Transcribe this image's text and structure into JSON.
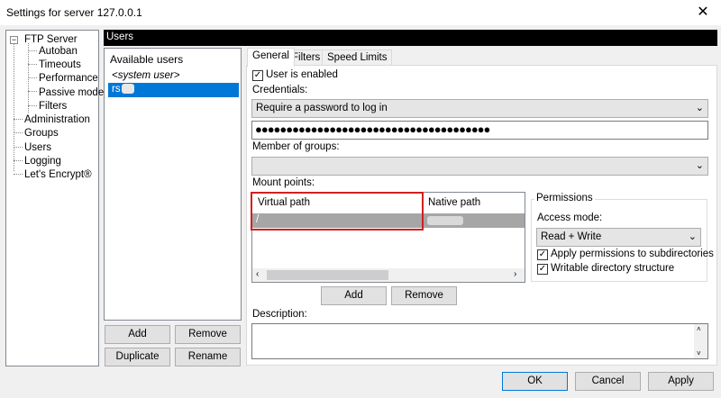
{
  "window": {
    "title": "Settings for server 127.0.0.1",
    "close_glyph": "✕"
  },
  "tree": {
    "items": [
      {
        "id": "ftp",
        "label": "FTP Server",
        "expander": "−"
      },
      {
        "id": "autoban",
        "label": "Autoban"
      },
      {
        "id": "timeouts",
        "label": "Timeouts"
      },
      {
        "id": "performance",
        "label": "Performance"
      },
      {
        "id": "passive",
        "label": "Passive mode"
      },
      {
        "id": "filters",
        "label": "Filters"
      },
      {
        "id": "admin",
        "label": "Administration"
      },
      {
        "id": "groups",
        "label": "Groups"
      },
      {
        "id": "users",
        "label": "Users"
      },
      {
        "id": "logging",
        "label": "Logging"
      },
      {
        "id": "letsencrypt",
        "label": "Let's Encrypt®"
      }
    ]
  },
  "users_header": "Users",
  "user_list": {
    "header": "Available users",
    "system_user": "<system user>",
    "selected_user": "rs"
  },
  "user_buttons": {
    "add": "Add",
    "remove": "Remove",
    "duplicate": "Duplicate",
    "rename": "Rename"
  },
  "tabs": [
    {
      "label": "General",
      "active": true
    },
    {
      "label": "Filters",
      "active": false
    },
    {
      "label": "Speed Limits",
      "active": false
    }
  ],
  "general": {
    "user_enabled_label": "User is enabled",
    "user_enabled": true,
    "credentials_label": "Credentials:",
    "credentials_value": "Require a password to log in",
    "password_mask": "●●●●●●●●●●●●●●●●●●●●●●●●●●●●●●●●●●●●●●",
    "member_of_groups_label": "Member of groups:",
    "member_of_groups_value": "",
    "mount_points_label": "Mount points:",
    "mount_columns": {
      "virtual": "Virtual path",
      "native": "Native path"
    },
    "mount_rows": [
      {
        "virtual": "/",
        "native": ""
      }
    ],
    "mount_add": "Add",
    "mount_remove": "Remove",
    "permissions": {
      "group_label": "Permissions",
      "access_mode_label": "Access mode:",
      "access_mode_value": "Read + Write",
      "apply_subdirs_label": "Apply permissions to subdirectories",
      "apply_subdirs": true,
      "writable_label": "Writable directory structure",
      "writable": true
    },
    "description_label": "Description:",
    "description_value": ""
  },
  "footer": {
    "ok": "OK",
    "cancel": "Cancel",
    "apply": "Apply"
  },
  "colors": {
    "selection": "#0078d7",
    "highlight_box": "#d21f1f",
    "row_selected": "#a6a6a6"
  }
}
